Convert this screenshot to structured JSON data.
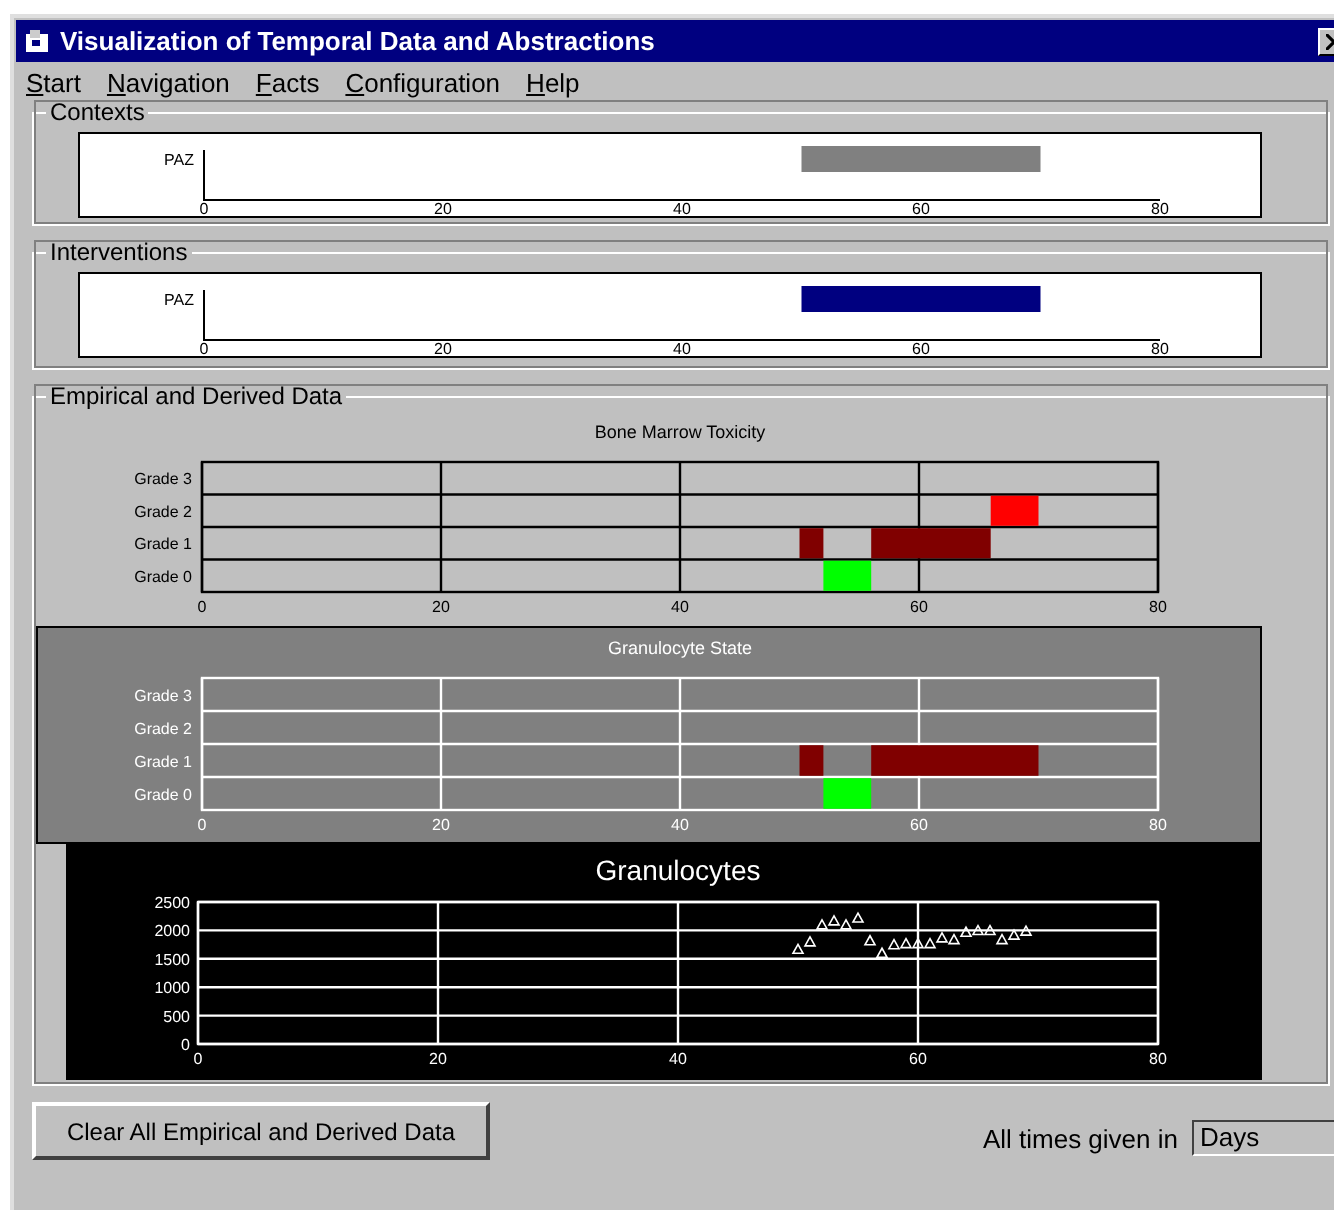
{
  "window": {
    "title": "Visualization of Temporal Data and Abstractions"
  },
  "menu": [
    {
      "label": "Start"
    },
    {
      "label": "Navigation"
    },
    {
      "label": "Facts"
    },
    {
      "label": "Configuration"
    },
    {
      "label": "Help"
    }
  ],
  "contexts": {
    "label": "Contexts",
    "kind": "axis",
    "timeline": {
      "rows": [
        {
          "label": "PAZ"
        }
      ],
      "ticks": [
        "0",
        "20",
        "40",
        "60",
        "80"
      ]
    }
  },
  "interventions": {
    "label": "Interventions",
    "kind": "axis",
    "timeline": {
      "rows": [
        {
          "label": "PAZ"
        }
      ],
      "ticks": [
        "0",
        "20",
        "40",
        "60",
        "80"
      ]
    }
  },
  "empirical": {
    "label": "Empirical and Derived Data",
    "panels": [
      {
        "kind": "grid",
        "timeline": {
          "title": "Bone Marrow Toxicity",
          "rows": [
            {
              "label": "Grade 3"
            },
            {
              "label": "Grade 2"
            },
            {
              "label": "Grade 1"
            },
            {
              "label": "Grade 0"
            }
          ],
          "ticks": [
            "0",
            "20",
            "40",
            "60",
            "80"
          ]
        }
      },
      {
        "kind": "grid-inverse",
        "timeline": {
          "title": "Granulocyte State",
          "rows": [
            {
              "label": "Grade 3"
            },
            {
              "label": "Grade 2"
            },
            {
              "label": "Grade 1"
            },
            {
              "label": "Grade 0"
            }
          ],
          "ticks": [
            "0",
            "20",
            "40",
            "60",
            "80"
          ]
        }
      },
      {
        "kind": "dark",
        "chart_data": {
          "type": "scatter",
          "title": "Granulocytes",
          "grid": true,
          "xlim": [
            0,
            80
          ],
          "ylim": [
            0,
            2500
          ],
          "xticks": [
            0,
            20,
            40,
            60,
            80
          ],
          "yticks": [
            0,
            500,
            1000,
            1500,
            2000,
            2500
          ],
          "x": [
            50,
            51,
            52,
            53,
            54,
            55,
            56,
            57,
            58,
            59,
            60,
            61,
            62,
            63,
            64,
            65,
            66,
            67,
            68,
            69
          ],
          "series": [
            {
              "color": "#ffffff",
              "values": [
                1650,
                1780,
                2080,
                2150,
                2080,
                2200,
                1800,
                1580,
                1730,
                1750,
                1750,
                1750,
                1850,
                1820,
                1950,
                1980,
                1980,
                1820,
                1900,
                1970
              ]
            }
          ]
        }
      }
    ]
  },
  "clear_button": {
    "label": "Clear All Empirical and Derived Data"
  },
  "time_unit": {
    "label": "All times given in",
    "value": "Days"
  }
}
